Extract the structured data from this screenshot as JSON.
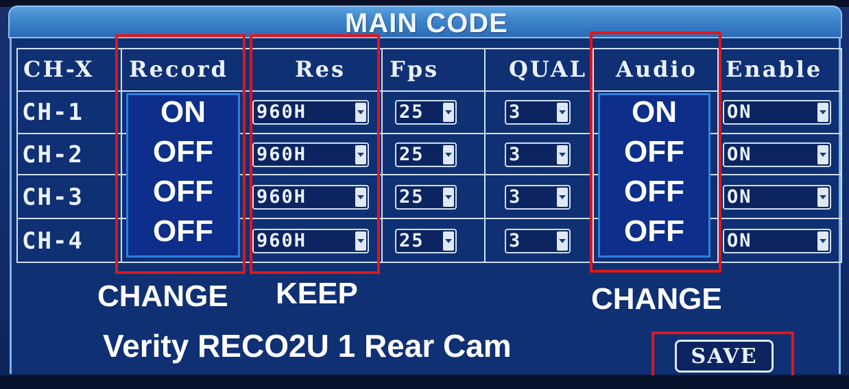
{
  "window": {
    "title": "MAIN CODE"
  },
  "table": {
    "columns": [
      "CH-X",
      "Record",
      "Res",
      "Fps",
      "QUAL",
      "Audio",
      "Enable"
    ],
    "rows": [
      {
        "channel": "CH-1",
        "res": "960H",
        "fps": "25",
        "qual": "3",
        "enable": "ON"
      },
      {
        "channel": "CH-2",
        "res": "960H",
        "fps": "25",
        "qual": "3",
        "enable": "ON"
      },
      {
        "channel": "CH-3",
        "res": "960H",
        "fps": "25",
        "qual": "3",
        "enable": "ON"
      },
      {
        "channel": "CH-4",
        "res": "960H",
        "fps": "25",
        "qual": "3",
        "enable": "ON"
      }
    ]
  },
  "overlays": {
    "record_values": [
      "ON",
      "OFF",
      "OFF",
      "OFF"
    ],
    "audio_values": [
      "ON",
      "OFF",
      "OFF",
      "OFF"
    ]
  },
  "annotations": {
    "record_note": "CHANGE",
    "res_note": "KEEP",
    "audio_note": "CHANGE"
  },
  "footer": {
    "caption": "Verity  RECO2U 1 Rear Cam",
    "save_label": "SAVE"
  },
  "colors": {
    "panel_bg": "#103074",
    "title_bar": "#3f86cc",
    "highlight_red": "#e0161a",
    "overlay_blue": "#0d2e8a"
  }
}
